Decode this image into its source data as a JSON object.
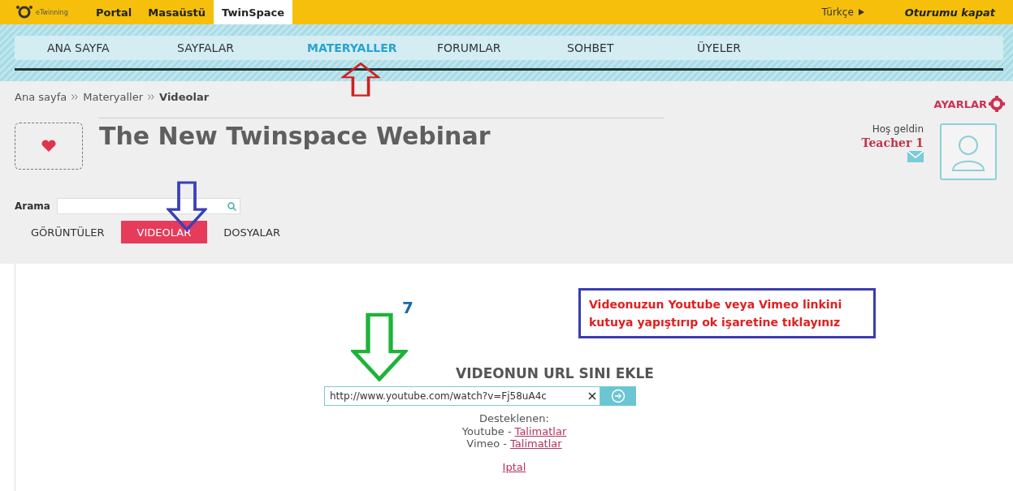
{
  "top_bar": {
    "logo_text": "eTwinning",
    "tabs": [
      {
        "label": "Portal",
        "selected": false
      },
      {
        "label": "Masaüstü",
        "selected": false
      },
      {
        "label": "TwinSpace",
        "selected": true
      }
    ],
    "language": "Türkçe",
    "logout": "Oturumu kapat"
  },
  "nav": [
    {
      "label": "ANA SAYFA",
      "selected": false
    },
    {
      "label": "SAYFALAR",
      "selected": false
    },
    {
      "label": "MATERYALLER",
      "selected": true
    },
    {
      "label": "FORUMLAR",
      "selected": false
    },
    {
      "label": "SOHBET",
      "selected": false
    },
    {
      "label": "ÜYELER",
      "selected": false
    }
  ],
  "breadcrumb": [
    "Ana sayfa",
    "Materyaller",
    "Videolar"
  ],
  "settings": "AYARLAR",
  "title": "The New Twinspace Webinar",
  "welcome": "Hoş geldin",
  "user": "Teacher 1",
  "search": {
    "label": "Arama"
  },
  "tabs": [
    {
      "label": "GÖRÜNTÜLER",
      "selected": false
    },
    {
      "label": "VIDEOLAR",
      "selected": true
    },
    {
      "label": "DOSYALAR",
      "selected": false
    }
  ],
  "url_form": {
    "heading": "VIDEONUN URL SINI EKLE",
    "value": "http://www.youtube.com/watch?v=Fj58uA4c",
    "supported": "Desteklenen:",
    "sources": [
      {
        "name": "Youtube -",
        "link": "Talimatlar"
      },
      {
        "name": "Vimeo -",
        "link": "Talimatlar"
      }
    ],
    "cancel": "Iptal"
  },
  "annotations": {
    "step": "7",
    "callout": "Videonuzun Youtube veya Vimeo linkini kutuya yapıştırıp ok işaretine tıklayınız"
  }
}
